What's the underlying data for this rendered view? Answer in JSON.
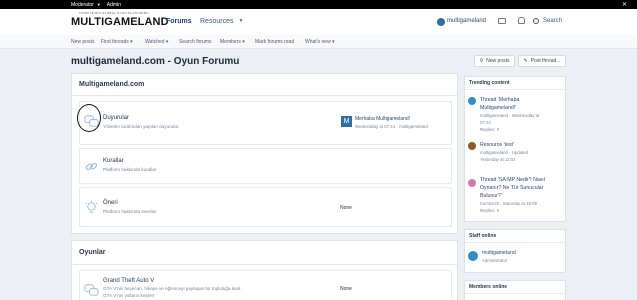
{
  "staff_bar": {
    "moderator": "Moderator",
    "admin": "Admin",
    "close": "✕"
  },
  "header": {
    "logo_tagline": "TÜRKİYE'NİN GLOBAL OYUN PLATFORMU",
    "logo_text": "MULTIGAMELAND",
    "nav": {
      "forums": "Forums",
      "resources": "Resources"
    },
    "username": "multigameland",
    "search_label": "Search"
  },
  "subnav": [
    "New posts",
    "Find threads ▾",
    "Watched ▾",
    "Search forums",
    "Members ▾",
    "Mark forums read",
    "What's new ▾"
  ],
  "page": {
    "title": "multigameland.com - Oyun Forumu",
    "new_posts_button": "New posts",
    "post_thread_button": "Post thread..."
  },
  "categories": [
    {
      "name": "Multigameland.com",
      "nodes": [
        {
          "title": "Duyurular",
          "desc": "Yönetim tarafından yapılan duyurular.",
          "last_avatar": "M",
          "last_title": "Merhaba Multigameland!",
          "last_meta": "Wednesday at 07:24 · multigameland"
        },
        {
          "title": "Kurallar",
          "desc": "Platform hakkında kurallar",
          "none": ""
        },
        {
          "title": "Öneri",
          "desc": "Platform hakkında öneriler",
          "none": "None"
        }
      ]
    },
    {
      "name": "Oyunlar",
      "nodes": [
        {
          "title": "Grand Theft Auto V",
          "desc": "GTA V'nin heyecan, hikaye ve eğlenceyi paylaşan bir topluluğa katıl.",
          "desc2": "GTA V'nin yolların keşfet!",
          "none": "None"
        }
      ]
    }
  ],
  "sidebar": {
    "trending": {
      "heading": "Trending content",
      "items": [
        {
          "lines": [
            "Thread 'Merhaba",
            "Multigameland!'"
          ],
          "meta": [
            "multigameland · Wednesday at",
            "07:24",
            "Replies: 0"
          ],
          "avatar_color": "#2e8fc0"
        },
        {
          "lines": [
            "Resource 'test'"
          ],
          "meta": [
            "multigameland · Updated",
            "Yesterday at 11:02"
          ],
          "avatar_color": "#8a5a2a"
        },
        {
          "lines": [
            "Thread 'SA:MP Nedir? Nasıl",
            "Oynanır? Ne Tür Sunucular",
            "Bulunur?'"
          ],
          "meta": [
            "Kumlos20 · Saturday at 18:09",
            "Replies: 0"
          ],
          "avatar_color": "#d47aa8"
        }
      ]
    },
    "staff_online": {
      "heading": "Staff online",
      "name": "multigameland",
      "role": "Administrator"
    },
    "members_online": {
      "heading": "Members online"
    }
  },
  "colors": {
    "accent": "#2e6ea0",
    "staff_bar": "#000000",
    "background": "#eceff3"
  }
}
